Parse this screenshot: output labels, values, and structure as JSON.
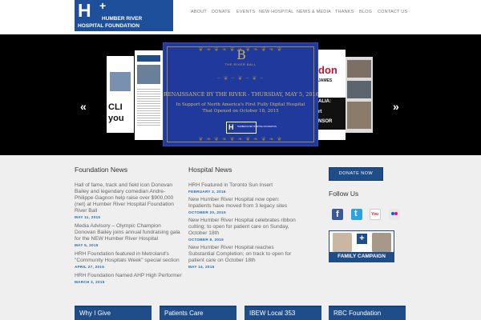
{
  "header": {
    "logo": {
      "mark": "H",
      "plus": "+",
      "line1": "HUMBER RIVER",
      "line2": "HOSPITAL FOUNDATION"
    },
    "nav": [
      "ABOUT",
      "DONATE",
      "EVENTS",
      "NEW HOSPITAL",
      "NEWS & MEDIA",
      "THANKS",
      "BLOG",
      "CONTACT US"
    ]
  },
  "slider": {
    "prev_arrow": "«",
    "next_arrow": "»",
    "feature": {
      "ornament": "B",
      "kicker": "THE RIVER BALL",
      "title": "RENAISSANCE BY THE RIVER - THURSDAY, MAY 5, 2016",
      "sub1": "In Support of North America's First Fully Digital Hospital",
      "sub2": "That Opened on October 18, 2015",
      "logo_mark": "H",
      "logo_text": "HUMBER RIVER HOSPITAL FOUNDATION"
    },
    "side_cards": {
      "left_text": "CLI",
      "left_text2": "you",
      "right_text1": "ALIA:",
      "right_text2": "NSOR",
      "right_text3": "rt",
      "right_brand": "don",
      "right_brand2": "JAMES"
    }
  },
  "foundation_news": {
    "title": "Foundation News",
    "items": [
      {
        "text": "Hall of fame, track and field icon Donovan Bailey and legendary comedian Andre-Philippe Gagnon help raise over $900,000 (net) at Humber River Hospital Foundation River Ball",
        "date": "MAY 11, 2015"
      },
      {
        "text": "Media Advisory – Olympic Champion Donovan Bailey joins annual fundraising gala for the NEW Humber River Hospital",
        "date": "MAY 5, 2015"
      },
      {
        "text": "HRH Foundation featured in Metroland's \"Community Hospitals Week\" special section",
        "date": "APRIL 27, 2015"
      },
      {
        "text": "HRH Foundation Named AHP High Performer",
        "date": "MARCH 3, 2015"
      }
    ]
  },
  "hospital_news": {
    "title": "Hospital News",
    "items": [
      {
        "text": "HRH Featured in Toronto Sun Insert",
        "date": "FEBRUARY 2, 2016"
      },
      {
        "text": "New Humber River Hospital now open: Inpatients have moved from 3 legacy sites",
        "date": "OCTOBER 20, 2015"
      },
      {
        "text": "New Humber River Hospital celebrates ribbon cutting; to open for patient care on Sunday, October 18th",
        "date": "OCTOBER 8, 2015"
      },
      {
        "text": "New Humber River Hospital reaches Substantial Completion; on track to open for patient care on October 18th",
        "date": "MAY 14, 2015"
      }
    ]
  },
  "sidebar": {
    "donate_label": "DONATE NOW",
    "follow_title": "Follow Us",
    "social": [
      {
        "name": "facebook-icon",
        "color": "#3b5998",
        "glyph": "f"
      },
      {
        "name": "twitter-icon",
        "color": "#2aa4e0",
        "glyph": "t"
      },
      {
        "name": "youtube-icon",
        "color": "#d32a2a",
        "glyph": "You"
      },
      {
        "name": "flickr-icon",
        "color": "#e8e8e8",
        "glyph": "••"
      }
    ],
    "family_campaign": "FAMILY CAMPAIGN",
    "family_plus": "+"
  },
  "tabs": [
    "Why I Give",
    "Patients Care",
    "IBEW Local 353",
    "RBC Foundation"
  ],
  "colors": {
    "brand": "#1e4d8a",
    "link_date": "#1d6bb5",
    "feature_bg": "#1f3a9c",
    "gold": "#d6b96b"
  }
}
